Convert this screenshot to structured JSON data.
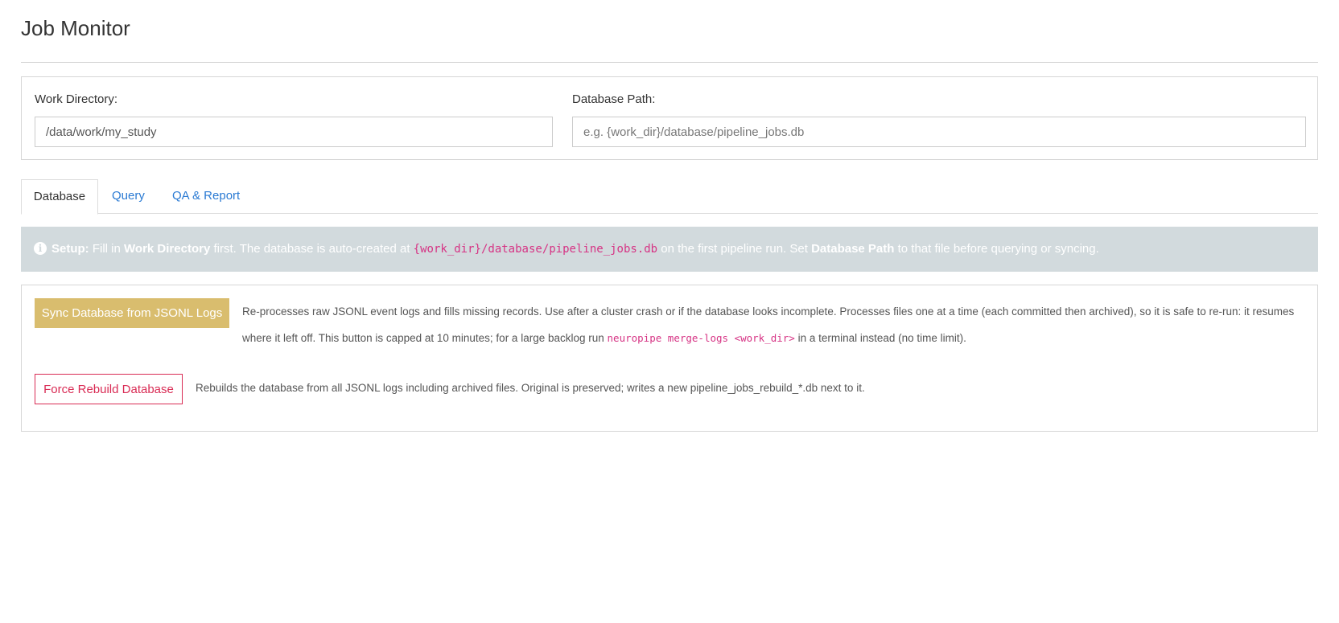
{
  "app": {
    "title": "Job Monitor"
  },
  "settings": {
    "work_dir_label": "Work Directory:",
    "work_dir_value": "/data/work/my_study",
    "db_path_label": "Database Path:",
    "db_path_value": "",
    "db_path_placeholder": "e.g. {work_dir}/database/pipeline_jobs.db"
  },
  "tabs": [
    {
      "label": "Database",
      "active": true
    },
    {
      "label": "Query",
      "active": false
    },
    {
      "label": "QA & Report",
      "active": false
    }
  ],
  "info_banner": {
    "icon": "info-circle-icon",
    "setup_label": "Setup:",
    "text_1": "Fill in",
    "work_dir_strong": "Work Directory",
    "text_2": "first. The database is auto-created at",
    "db_path_code": "{work_dir}/database/pipeline_jobs.db",
    "text_3": "on the first pipeline run. Set",
    "db_path_strong": "Database Path",
    "text_4": "to that file before querying or syncing."
  },
  "actions": {
    "sync_button_label": "Sync Database from JSONL Logs",
    "sync_help_1": "Re-processes raw JSONL event logs and fills missing records. Use after a cluster crash or if the database looks incomplete. Processes files one at a time (each committed then archived), so it is safe to re-run: it resumes where it left off. This button is capped at 10 minutes; for a large backlog run",
    "sync_help_cmd": "neuropipe merge-logs <work_dir>",
    "sync_help_2": "in a terminal instead (no time limit).",
    "rebuild_button_label": "Force Rebuild Database",
    "rebuild_help": "Rebuilds the database from all JSONL logs including archived files. Original is preserved; writes a new pipeline_jobs_rebuild_*.db next to it."
  },
  "colors": {
    "accent_link": "#2a7ad3",
    "banner_bg": "#d2dadd",
    "sync_button_bg": "#d9bd6e",
    "danger": "#d92c55",
    "code": "#d63384"
  }
}
